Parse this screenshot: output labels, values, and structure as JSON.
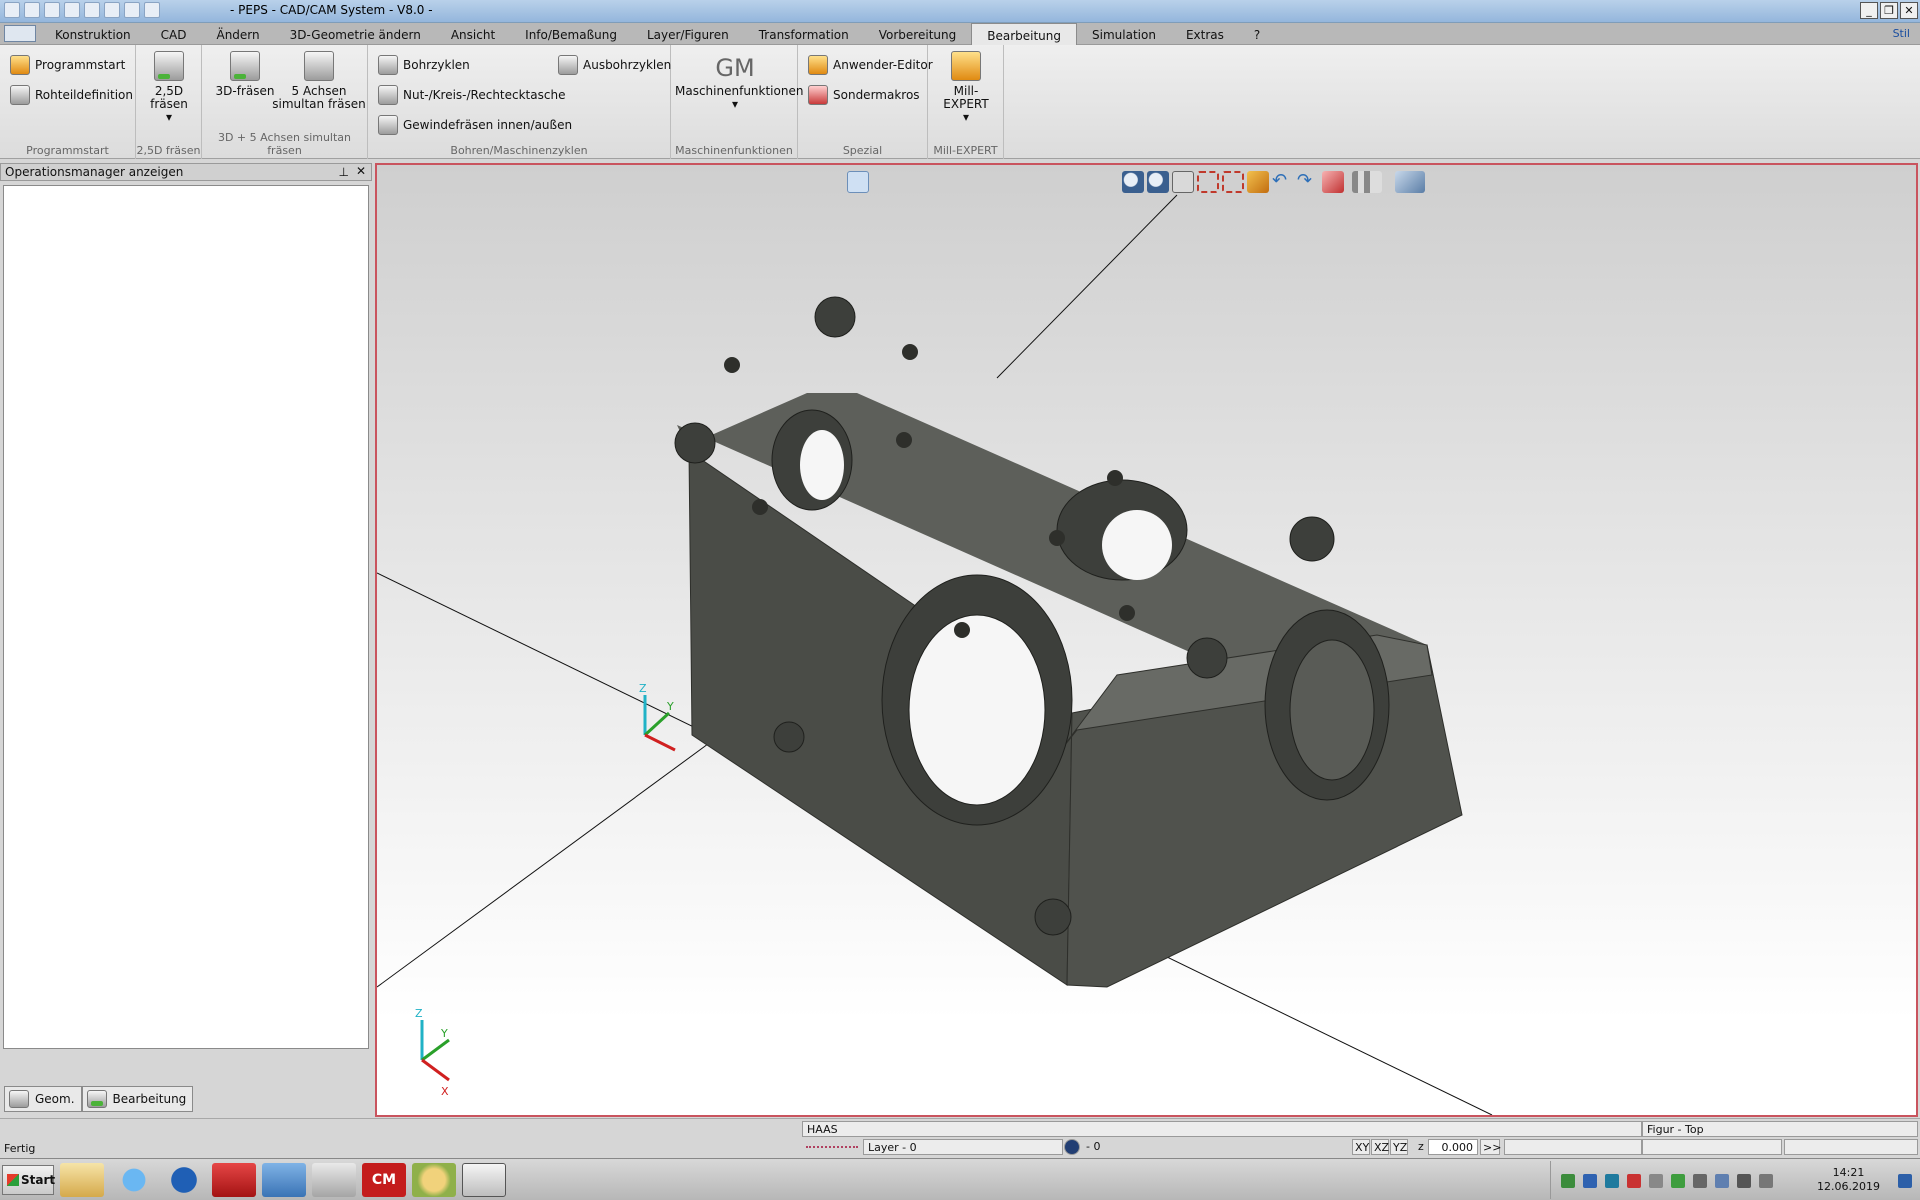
{
  "window": {
    "title": "- PEPS - CAD/CAM System - V8.0 -"
  },
  "menu": {
    "tabs": [
      "Konstruktion",
      "CAD",
      "Ändern",
      "3D-Geometrie ändern",
      "Ansicht",
      "Info/Bemaßung",
      "Layer/Figuren",
      "Transformation",
      "Vorbereitung",
      "Bearbeitung",
      "Simulation",
      "Extras",
      "?"
    ],
    "active": "Bearbeitung",
    "style_label": "Stil"
  },
  "ribbon": {
    "programmstart": {
      "title": "Programmstart",
      "items": [
        "Programmstart",
        "Rohteildefinition"
      ]
    },
    "fraesen25": {
      "title": "2,5D fräsen",
      "line1": "2,5D",
      "line2": "fräsen"
    },
    "fraesen3d": {
      "title": "3D + 5 Achsen simultan fräsen",
      "btn1": "3D-fräsen",
      "btn2_line1": "5 Achsen",
      "btn2_line2": "simultan fräsen"
    },
    "bohren": {
      "title": "Bohren/Maschinenzyklen",
      "items": [
        "Bohrzyklen",
        "Nut-/Kreis-/Rechtecktasche",
        "Gewindefräsen innen/außen"
      ],
      "aus": "Ausbohrzyklen"
    },
    "maschinen": {
      "title": "Maschinenfunktionen",
      "btn": "Maschinenfunktionen",
      "glyph": "GM"
    },
    "spezial": {
      "title": "Spezial",
      "items": [
        "Anwender-Editor",
        "Sondermakros"
      ]
    },
    "millexpert": {
      "title": "Mill-EXPERT",
      "btn": "Mill-EXPERT"
    }
  },
  "leftpanel": {
    "title": "Operationsmanager anzeigen",
    "tabs": [
      "Geom.",
      "Bearbeitung"
    ]
  },
  "viewport": {
    "axis_labels": {
      "x": "X",
      "y": "Y",
      "z": "Z"
    },
    "colors": {
      "part": "#4a4c47",
      "part_top": "#62645f",
      "border": "#c9545e"
    }
  },
  "status": {
    "machine": "HAAS",
    "layer": "Layer - 0",
    "pen": "- 0",
    "planes": [
      "XY",
      "XZ",
      "YZ"
    ],
    "z_label": "z",
    "z_value": "0.000",
    "more": ">>",
    "figure": "Figur  - Top",
    "ready": "Fertig"
  },
  "taskbar": {
    "start": "Start",
    "time": "14:21",
    "date": "12.06.2019",
    "cm_label": "CM"
  }
}
